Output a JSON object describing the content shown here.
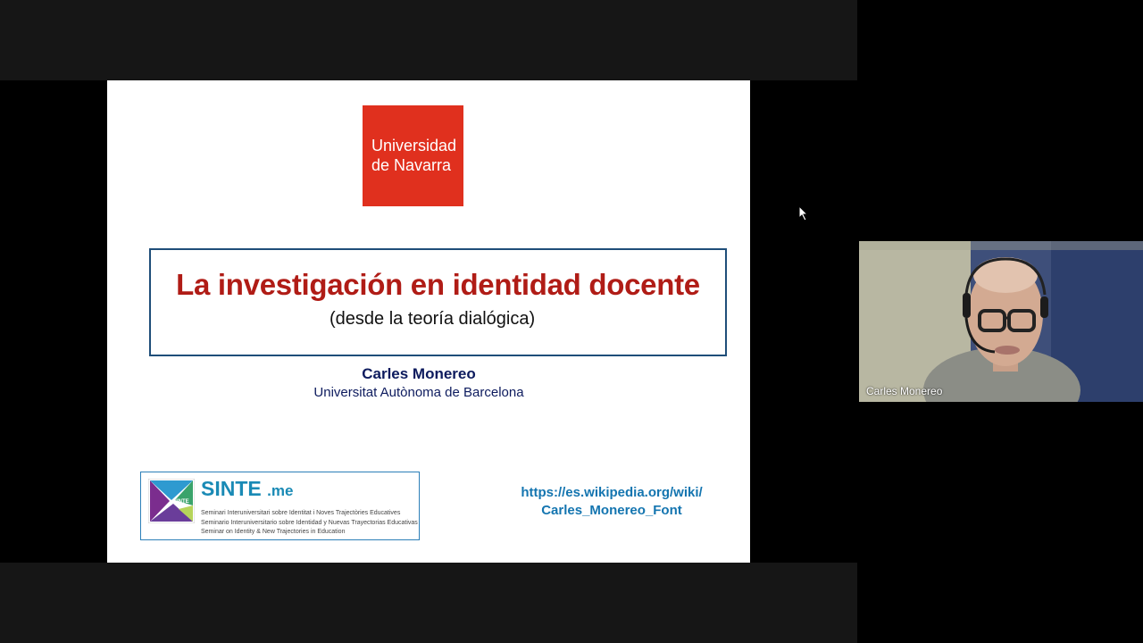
{
  "slide": {
    "logo_line1": "Universidad",
    "logo_line2": "de Navarra",
    "title": "La investigación en identidad docente",
    "subtitle": "(desde la teoría dialógica)",
    "author": "Carles Monereo",
    "affiliation": "Universitat Autònoma de Barcelona",
    "sinte": {
      "name": "SINTE",
      "suffix": ".me",
      "icon_text": "SINTE",
      "line1": "Seminari Interuniversitari sobre Identitat i Noves Trajectòries Educatives",
      "line2": "Seminario Interuniversitario sobre Identidad y Nuevas Trayectorias Educativas",
      "line3": "Seminar on Identity & New Trajectories in Education"
    },
    "link_line1": "https://es.wikipedia.org/wiki/",
    "link_line2": "Carles_Monereo_Font"
  },
  "participant": {
    "name": "Carles Monereo"
  },
  "colors": {
    "brand_red": "#e0301e",
    "title_red": "#b01c16",
    "navy": "#0d1b5e",
    "link_blue": "#1475b0"
  }
}
